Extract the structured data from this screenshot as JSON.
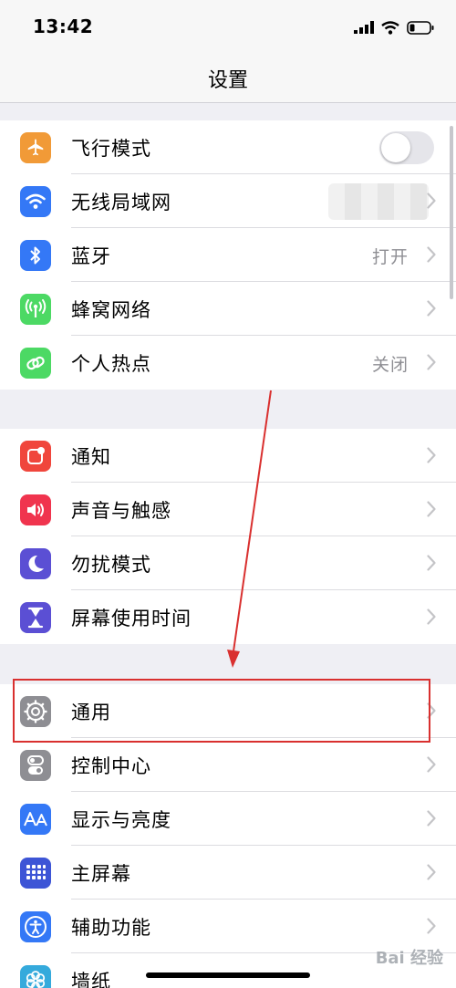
{
  "status_bar": {
    "time": "13:42"
  },
  "nav": {
    "title": "设置"
  },
  "groups": [
    {
      "items": [
        {
          "label": "飞行模式",
          "icon": "airplane-icon",
          "color": "#f19a37",
          "control": "toggle",
          "toggle_on": false
        },
        {
          "label": "无线局域网",
          "icon": "wifi-icon",
          "color": "#3478f6",
          "control": "blurred-value"
        },
        {
          "label": "蓝牙",
          "icon": "bluetooth-icon",
          "color": "#3478f6",
          "value": "打开"
        },
        {
          "label": "蜂窝网络",
          "icon": "cellular-antenna-icon",
          "color": "#4cd964"
        },
        {
          "label": "个人热点",
          "icon": "hotspot-link-icon",
          "color": "#4cd964",
          "value": "关闭"
        }
      ]
    },
    {
      "items": [
        {
          "label": "通知",
          "icon": "notification-icon",
          "color": "#f0463c"
        },
        {
          "label": "声音与触感",
          "icon": "speaker-icon",
          "color": "#f0344e"
        },
        {
          "label": "勿扰模式",
          "icon": "moon-icon",
          "color": "#5b4fd4"
        },
        {
          "label": "屏幕使用时间",
          "icon": "hourglass-icon",
          "color": "#5b4fd4"
        }
      ]
    },
    {
      "items": [
        {
          "label": "通用",
          "icon": "gear-icon",
          "color": "#8e8e93"
        },
        {
          "label": "控制中心",
          "icon": "switches-icon",
          "color": "#8e8e93"
        },
        {
          "label": "显示与亮度",
          "icon": "aa-text-icon",
          "color": "#3478f6"
        },
        {
          "label": "主屏幕",
          "icon": "app-grid-icon",
          "color": "#3d55d6"
        },
        {
          "label": "辅助功能",
          "icon": "accessibility-icon",
          "color": "#3478f6"
        },
        {
          "label": "墙纸",
          "icon": "wallpaper-flower-icon",
          "color": "#35aadc"
        }
      ]
    }
  ],
  "annotation": {
    "color": "#d9302f"
  },
  "watermark": "Bai 经验"
}
